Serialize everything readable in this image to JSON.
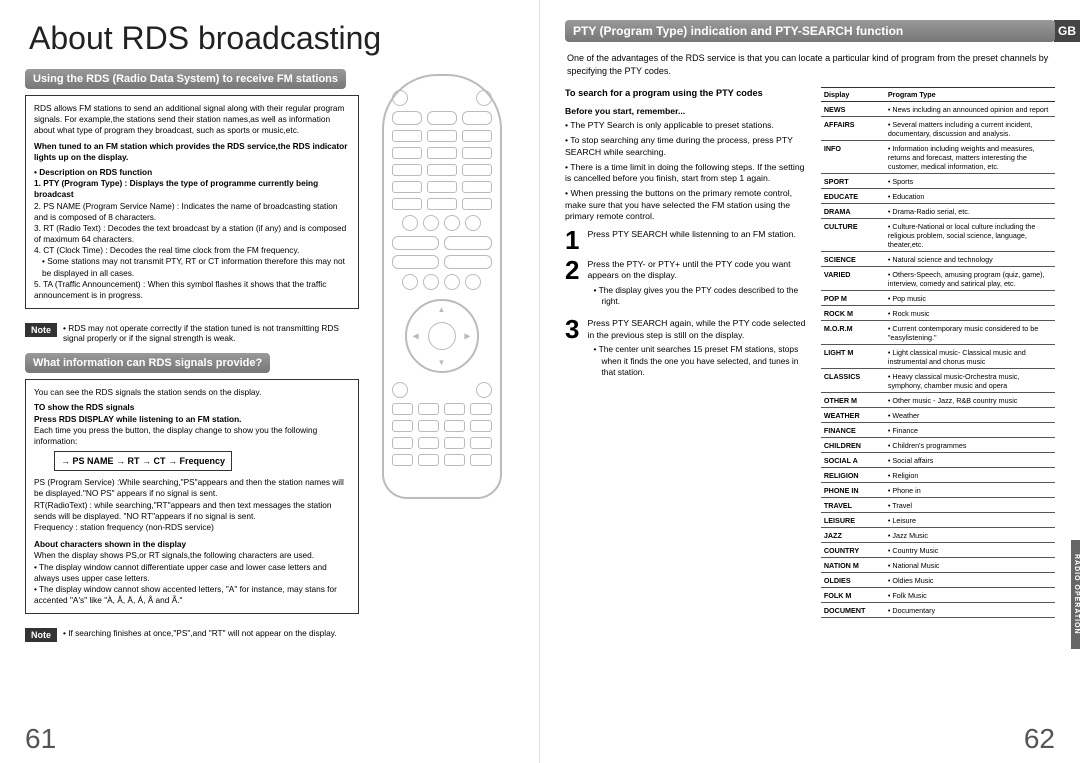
{
  "gb": "GB",
  "sideTab": "RADIO OPERATION",
  "pageLeft": "61",
  "pageRight": "62",
  "left": {
    "title": "About RDS broadcasting",
    "h1": "Using the RDS (Radio Data System) to receive FM stations",
    "intro": "RDS allows FM stations to send an additional signal along with their regular program signals. For example,the stations send their station names,as well as information about what type of program they broadcast, such as sports or music,etc.",
    "tunedLine": "When tuned to an FM station which provides the RDS service,the RDS indicator lights up on the display.",
    "descHeading": "• Description on RDS function",
    "d1": "1. PTY (Program Type) : Displays the type of programme currently being broadcast",
    "d2": "2. PS NAME (Program Service Name) : Indicates the name of broadcasting station and is composed of 8 characters.",
    "d3": "3. RT (Radio Text) : Decodes the text broadcast by a station (if any) and is composed of maximum 64 characters.",
    "d4": "4. CT (Clock Time) : Decodes the real time clock from the FM frequency.",
    "d4b": "• Some stations may not transmit PTY, RT or CT information therefore this may not be displayed in all cases.",
    "d5": "5. TA (Traffic Announcement) : When this symbol flashes it shows that the traffic announcement is in progress.",
    "note1": "• RDS may not operate correctly if the station tuned is not transmitting RDS signal properly or if the signal strength is weak.",
    "h2": "What information can RDS signals provide?",
    "box2_line1": "You can see the RDS signals the station sends on the display.",
    "box2_heading1": "TO show the RDS signals",
    "box2_line2": "Press RDS DISPLAY while listening to an FM station.",
    "box2_line3": "Each time you press the button, the display change to show you the following information:",
    "sequence": "→ PS NAME → RT → CT → Frequency",
    "ps": "PS (Program Service) :While searching,\"PS\"appears and then the station names will be displayed.\"NO PS\" appears if no signal is sent.",
    "rt": "RT(RadioText) : while searching,\"RT\"appears and then text messages the station sends will be displayed. \"NO RT\"appears if no signal is sent.",
    "freq": "Frequency : station frequency (non-RDS service)",
    "box2_heading2": "About characters shown in the display",
    "chars1": "When the display shows PS,or RT signals,the following characters are used.",
    "chars2": "• The display window cannot differentiate upper case and lower case letters and always uses upper case letters.",
    "chars3": "• The display window cannot show accented letters, \"A\" for instance, may stans for accented \"A's\" like \"À, Â, Ä, Á, Å and Ã.\"",
    "note2": "• If searching finishes at once,\"PS\",and \"RT\" will not appear on the display.",
    "noteLabel": "Note"
  },
  "right": {
    "h1": "PTY (Program Type) indication and PTY-SEARCH function",
    "intro": "One of the advantages of the RDS service is that you can locate a particular kind of program from the preset channels by specifying the PTY codes.",
    "searchH": "To search for a program using the PTY codes",
    "beforeH": "Before you start, remember...",
    "b1": "• The PTY Search is only applicable to preset stations.",
    "b2": "• To stop searching any time during the process, press PTY SEARCH while searching.",
    "b3": "• There is a time limit in doing the following steps. If the setting is cancelled before you finish, start from step 1 again.",
    "b4": "• When pressing the buttons on the primary remote control, make sure that you have selected the FM station using the primary remote control.",
    "step1": "Press PTY SEARCH while listenning to an FM station.",
    "step2": "Press the PTY- or PTY+ until the PTY code you want appears on the display.",
    "step2b": "• The display gives you the PTY codes described to the right.",
    "step3": "Press PTY SEARCH again, while the PTY code selected in the previous step is still on the display.",
    "step3b": "• The center unit searches 15 preset FM stations, stops when it finds the one you have selected, and tunes in that station.",
    "th1": "Display",
    "th2": "Program Type",
    "rows": [
      {
        "k": "NEWS",
        "v": "• News including an announced opinion and report"
      },
      {
        "k": "AFFAIRS",
        "v": "• Several matters including a current incident, documentary, discussion and analysis."
      },
      {
        "k": "INFO",
        "v": "• Information including weights and measures, returns and forecast, matters interesting the customer, medical information, etc."
      },
      {
        "k": "SPORT",
        "v": "• Sports"
      },
      {
        "k": "EDUCATE",
        "v": "• Education"
      },
      {
        "k": "DRAMA",
        "v": "• Drama-Radio serial, etc."
      },
      {
        "k": "CULTURE",
        "v": "• Culture-National or local culture including the religious problem, social science, language, theater,etc."
      },
      {
        "k": "SCIENCE",
        "v": "• Natural science and technology"
      },
      {
        "k": "VARIED",
        "v": "• Others-Speech, amusing program (quiz, game), interview, comedy and satirical play, etc."
      },
      {
        "k": "POP M",
        "v": "• Pop music"
      },
      {
        "k": "ROCK M",
        "v": "• Rock music"
      },
      {
        "k": "M.O.R.M",
        "v": "• Current contemporary music considered to be \"easylistening.\""
      },
      {
        "k": "LIGHT M",
        "v": "• Light classical music- Classical music and instrumental and chorus music"
      },
      {
        "k": "CLASSICS",
        "v": "• Heavy classical music-Orchestra music, symphony, chamber music and opera"
      },
      {
        "k": "OTHER M",
        "v": "• Other music - Jazz, R&B country music"
      },
      {
        "k": "WEATHER",
        "v": "• Weather"
      },
      {
        "k": "FINANCE",
        "v": "• Finance"
      },
      {
        "k": "CHILDREN",
        "v": "• Children's programmes"
      },
      {
        "k": "SOCIAL A",
        "v": "• Social affairs"
      },
      {
        "k": "RELIGION",
        "v": "• Religion"
      },
      {
        "k": "PHONE IN",
        "v": "• Phone in"
      },
      {
        "k": "TRAVEL",
        "v": "• Travel"
      },
      {
        "k": "LEISURE",
        "v": "• Leisure"
      },
      {
        "k": "JAZZ",
        "v": "• Jazz Music"
      },
      {
        "k": "COUNTRY",
        "v": "• Country Music"
      },
      {
        "k": "NATION M",
        "v": "• National Music"
      },
      {
        "k": "OLDIES",
        "v": "• Oldies Music"
      },
      {
        "k": "FOLK M",
        "v": "• Folk Music"
      },
      {
        "k": "DOCUMENT",
        "v": "• Documentary"
      }
    ]
  }
}
